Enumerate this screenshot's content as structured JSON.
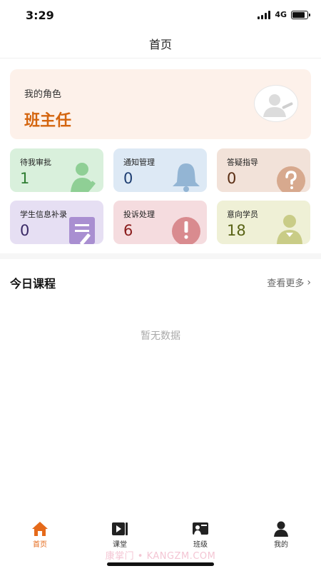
{
  "status_bar": {
    "time": "3:29",
    "network": "4G",
    "battery_level": 0.85
  },
  "nav": {
    "title": "首页"
  },
  "role_card": {
    "label": "我的角色",
    "value": "班主任",
    "avatar_icon": "user-avatar-icon"
  },
  "stats": [
    {
      "label": "待我审批",
      "value": "1",
      "bg": "#d9f0dc",
      "value_color": "#2e7d32",
      "icon": "user-edit-icon",
      "icon_color": "#8fcf95"
    },
    {
      "label": "通知管理",
      "value": "0",
      "bg": "#dde9f5",
      "value_color": "#1f3f73",
      "icon": "bell-icon",
      "icon_color": "#93b5d4"
    },
    {
      "label": "答疑指导",
      "value": "0",
      "bg": "#f2e2d9",
      "value_color": "#5a2e14",
      "icon": "question-icon",
      "icon_color": "#d7a98e"
    },
    {
      "label": "学生信息补录",
      "value": "0",
      "bg": "#e6dff3",
      "value_color": "#3a2a66",
      "icon": "form-edit-icon",
      "icon_color": "#a98fd1"
    },
    {
      "label": "投诉处理",
      "value": "6",
      "bg": "#f5dcdf",
      "value_color": "#8a1c1c",
      "icon": "alert-icon",
      "icon_color": "#d98b8f"
    },
    {
      "label": "意向学员",
      "value": "18",
      "bg": "#eff0d6",
      "value_color": "#5a6417",
      "icon": "student-icon",
      "icon_color": "#c9cc87"
    }
  ],
  "today_course": {
    "title": "今日课程",
    "more": "查看更多",
    "empty": "暂无数据"
  },
  "tabs": [
    {
      "label": "首页",
      "icon": "home-icon",
      "active": true
    },
    {
      "label": "课堂",
      "icon": "video-play-icon",
      "active": false
    },
    {
      "label": "班级",
      "icon": "class-board-icon",
      "active": false
    },
    {
      "label": "我的",
      "icon": "person-icon",
      "active": false
    }
  ],
  "watermark": "康掌门 • KANGZM.COM",
  "colors": {
    "accent": "#e56a1a",
    "role_text": "#d4650f"
  }
}
